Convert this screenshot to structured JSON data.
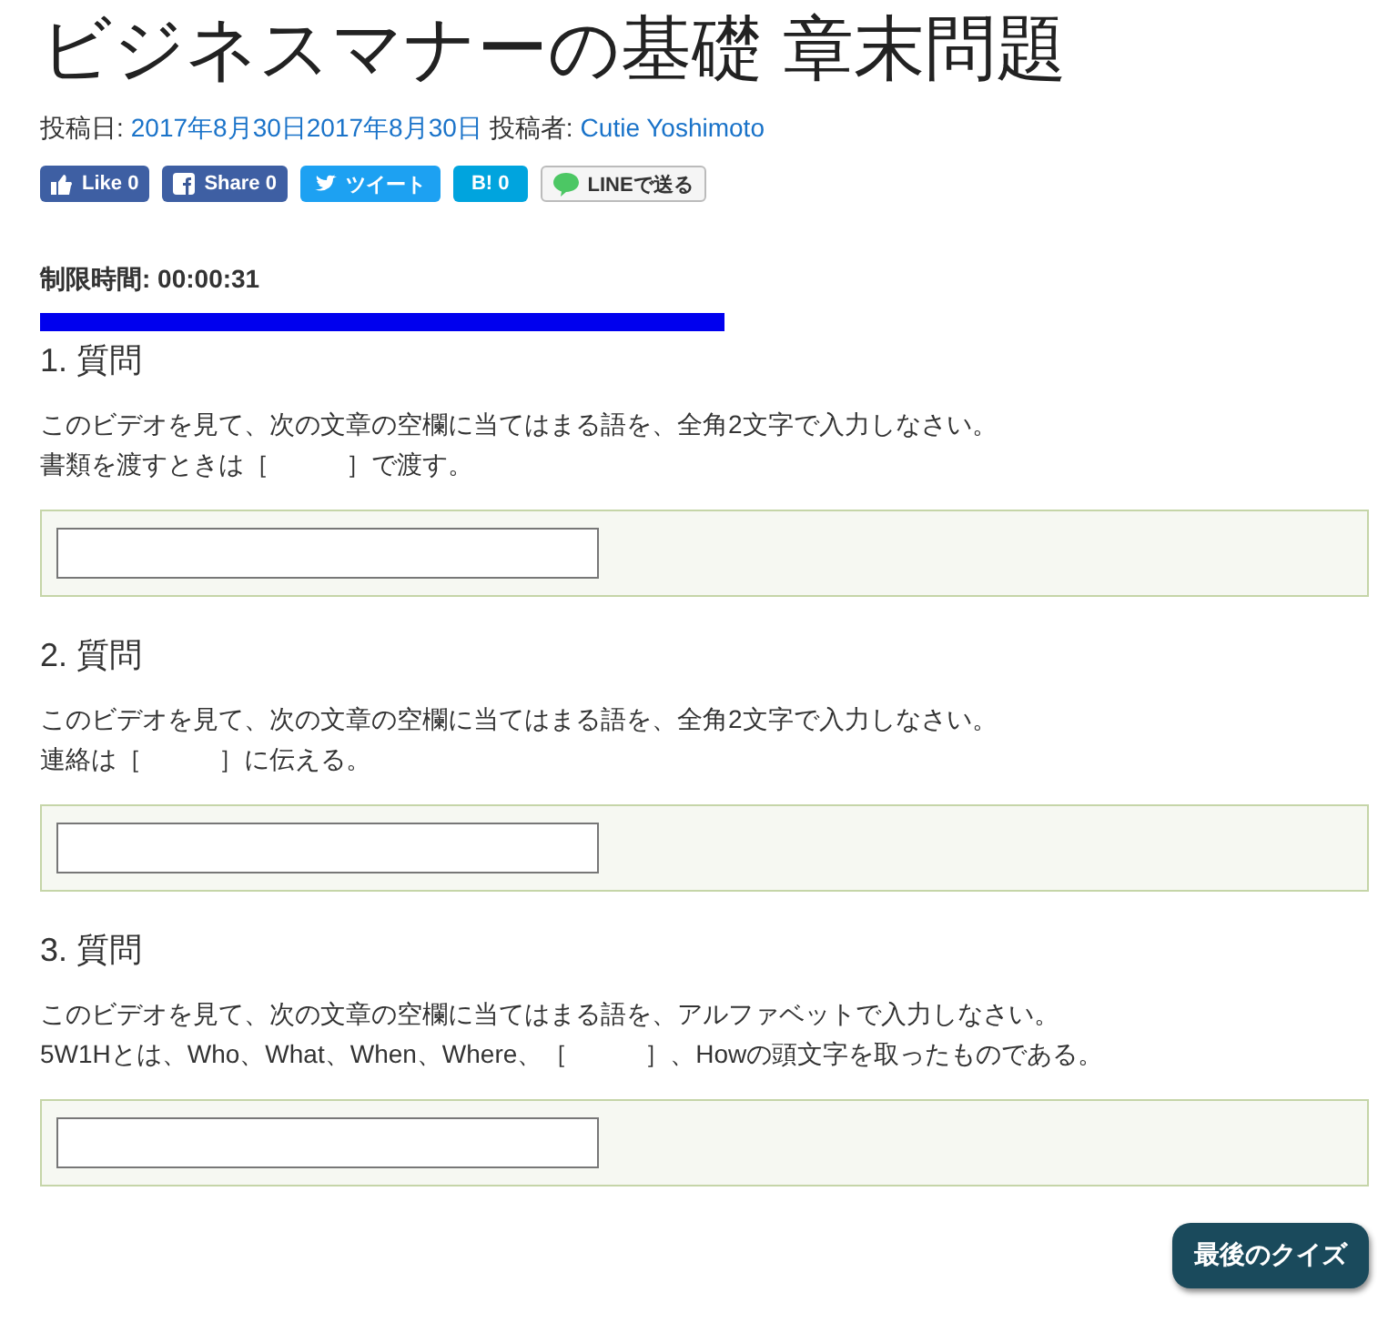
{
  "title": "ビジネスマナーの基礎 章末問題",
  "meta": {
    "date_label": "投稿日:",
    "date": "2017年8月30日2017年8月30日",
    "author_label": "投稿者:",
    "author": "Cutie Yoshimoto"
  },
  "share_buttons": [
    {
      "kind": "like",
      "label": "Like 0"
    },
    {
      "kind": "share",
      "label": "Share 0"
    },
    {
      "kind": "tweet",
      "label": "ツイート"
    },
    {
      "kind": "hatena",
      "label": "B! 0"
    },
    {
      "kind": "line",
      "label": "LINEで送る"
    }
  ],
  "timer": {
    "label": "制限時間: 00:00:31"
  },
  "questions": [
    {
      "title": "1. 質問",
      "lines": [
        "このビデオを見て、次の文章の空欄に当てはまる語を、全角2文字で入力しなさい。",
        "書類を渡すときは［　　　］で渡す。"
      ]
    },
    {
      "title": "2. 質問",
      "lines": [
        "このビデオを見て、次の文章の空欄に当てはまる語を、全角2文字で入力しなさい。",
        "連絡は［　　　］に伝える。"
      ]
    },
    {
      "title": "3. 質問",
      "lines": [
        "このビデオを見て、次の文章の空欄に当てはまる語を、アルファベットで入力しなさい。",
        "5W1Hとは、Who、What、When、Where、［　　　］、Howの頭文字を取ったものである。"
      ]
    }
  ],
  "next_button": "最後のクイズ"
}
